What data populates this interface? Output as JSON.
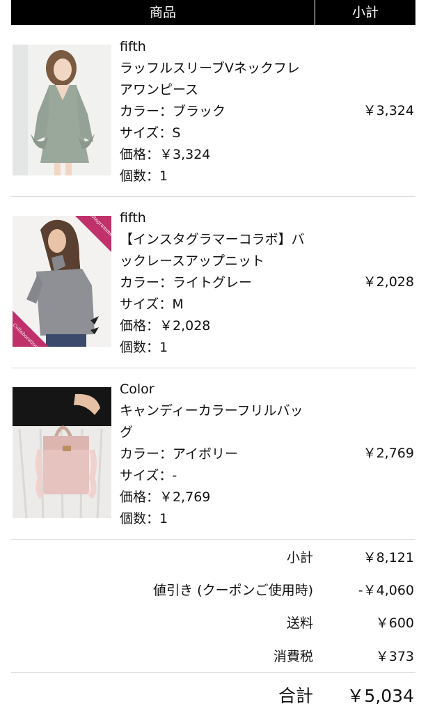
{
  "header": {
    "product_label": "商品",
    "subtotal_label": "小計"
  },
  "items": [
    {
      "brand": "fifth",
      "name_line1": "ラッフルスリーブVネックフレ",
      "name_line2": "アワンピース",
      "color": "カラー：ブラック",
      "size": "サイズ：S",
      "price": "価格：￥3,324",
      "qty": "個数：1",
      "subtotal": "￥3,324"
    },
    {
      "brand": "fifth",
      "name_line1": "【インスタグラマーコラボ】バ",
      "name_line2": "ックレースアップニット",
      "color": "カラー：ライトグレー",
      "size": "サイズ：M",
      "price": "価格：￥2,028",
      "qty": "個数：1",
      "subtotal": "￥2,028",
      "badge_top": "Instagrammer",
      "badge_bottom": "Collaboration"
    },
    {
      "brand": "Color",
      "name_line1": "キャンディーカラーフリルバッ",
      "name_line2": "グ",
      "color": "カラー：アイボリー",
      "size": "サイズ：-",
      "price": "価格：￥2,769",
      "qty": "個数：1",
      "subtotal": "￥2,769"
    }
  ],
  "summary": {
    "subtotal_label": "小計",
    "subtotal_value": "￥8,121",
    "discount_label": "値引き (クーポンご使用時)",
    "discount_value": "-￥4,060",
    "shipping_label": "送料",
    "shipping_value": "￥600",
    "tax_label": "消費税",
    "tax_value": "￥373",
    "total_label": "合計",
    "total_value": "￥5,034"
  }
}
